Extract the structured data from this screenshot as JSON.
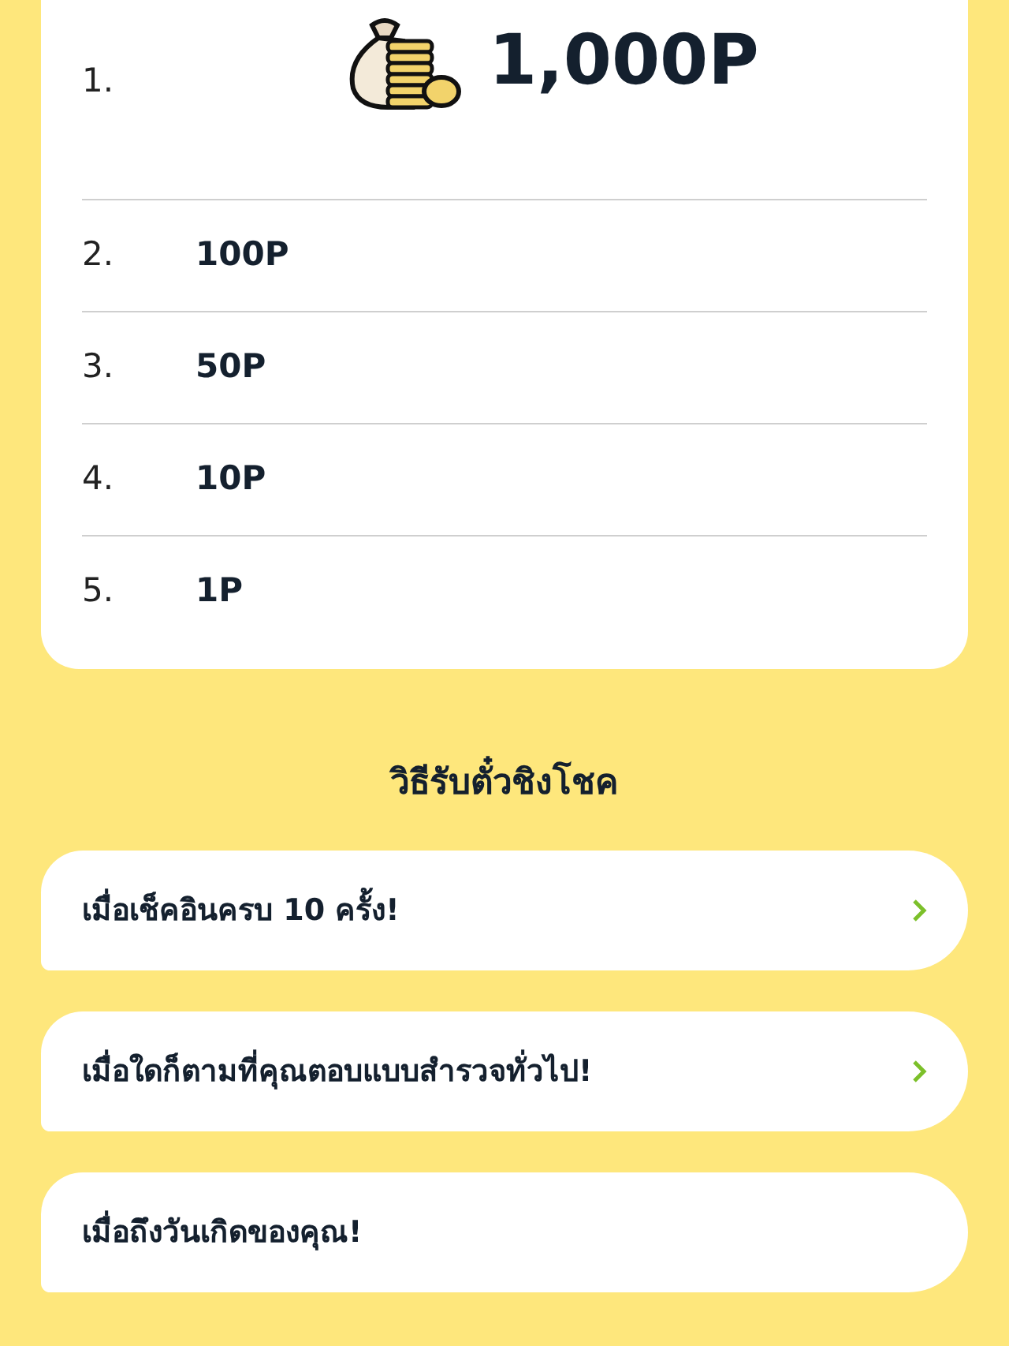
{
  "prizes": [
    {
      "rank": "1.",
      "amount": "1,000P",
      "kind": "featured"
    },
    {
      "rank": "2.",
      "amount": "100P",
      "kind": "plain"
    },
    {
      "rank": "3.",
      "amount": "50P",
      "kind": "plain"
    },
    {
      "rank": "4.",
      "amount": "10P",
      "kind": "plain"
    },
    {
      "rank": "5.",
      "amount": "1P",
      "kind": "plain"
    }
  ],
  "ways_title": "วิธีรับตั๋วชิงโชค",
  "ways": [
    {
      "label": "เมื่อเช็คอินครบ 10 ครั้ง!",
      "has_arrow": true
    },
    {
      "label": "เมื่อใดก็ตามที่คุณตอบแบบสำรวจทั่วไป!",
      "has_arrow": true
    },
    {
      "label": "เมื่อถึงวันเกิดของคุณ!",
      "has_arrow": false
    }
  ]
}
